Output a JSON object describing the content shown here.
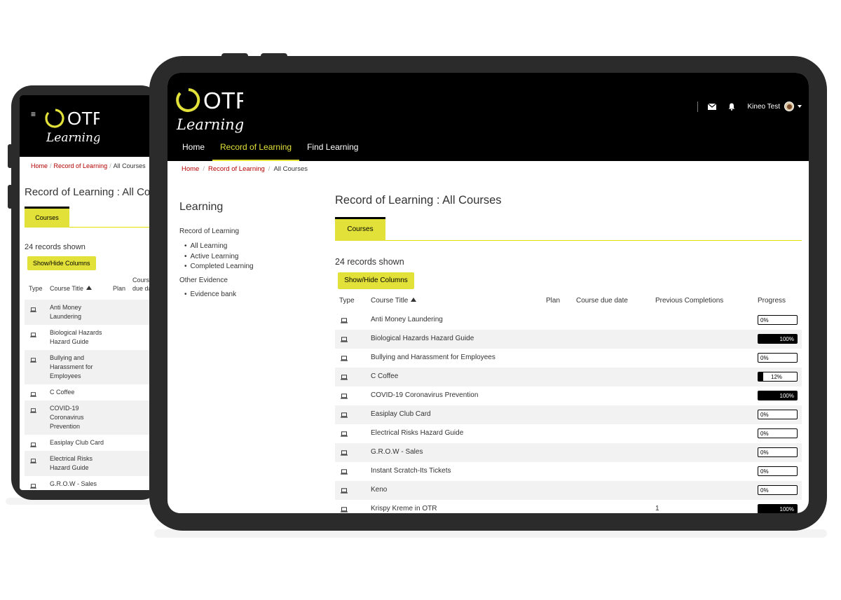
{
  "brand": {
    "logo_text": "OTR",
    "logo_sub": "Learning"
  },
  "colors": {
    "accent": "#e2e13a",
    "link": "#b30000",
    "header_bg": "#000000",
    "device_frame": "#2b2b2b"
  },
  "header": {
    "nav": [
      {
        "label": "Home",
        "active": false
      },
      {
        "label": "Record of Learning",
        "active": true
      },
      {
        "label": "Find Learning",
        "active": false
      }
    ],
    "user_name": "Kineo Test",
    "icons": [
      "envelope-icon",
      "bell-icon",
      "avatar",
      "caret-down-icon"
    ]
  },
  "breadcrumb": {
    "home": "Home",
    "record": "Record of Learning",
    "current": "All Courses"
  },
  "sidebar": {
    "title": "Learning",
    "section1": "Record of Learning",
    "section1_items": [
      "All Learning",
      "Active Learning",
      "Completed Learning"
    ],
    "section2": "Other Evidence",
    "section2_items": [
      "Evidence bank"
    ]
  },
  "main": {
    "title": "Record of Learning : All Courses",
    "tab": "Courses",
    "records": "24 records shown",
    "show_hide": "Show/Hide Columns",
    "columns": {
      "type": "Type",
      "course_title": "Course Title",
      "plan": "Plan",
      "due": "Course due date",
      "prev": "Previous Completions",
      "progress": "Progress"
    },
    "rows": [
      {
        "title": "Anti Money Laundering",
        "completions": "",
        "progress": 0,
        "progress_label": "0%"
      },
      {
        "title": "Biological Hazards Hazard Guide",
        "completions": "",
        "progress": 1,
        "progress_label": "100%"
      },
      {
        "title": "Bullying and Harassment for Employees",
        "completions": "",
        "progress": 0,
        "progress_label": "0%"
      },
      {
        "title": "C Coffee",
        "completions": "",
        "progress": 0.12,
        "progress_label": "12%"
      },
      {
        "title": "COVID-19 Coronavirus Prevention",
        "completions": "",
        "progress": 1,
        "progress_label": "100%"
      },
      {
        "title": "Easiplay Club Card",
        "completions": "",
        "progress": 0,
        "progress_label": "0%"
      },
      {
        "title": "Electrical Risks Hazard Guide",
        "completions": "",
        "progress": 0,
        "progress_label": "0%"
      },
      {
        "title": "G.R.O.W - Sales",
        "completions": "",
        "progress": 0,
        "progress_label": "0%"
      },
      {
        "title": "Instant Scratch-Its Tickets",
        "completions": "",
        "progress": 0,
        "progress_label": "0%"
      },
      {
        "title": "Keno",
        "completions": "",
        "progress": 0,
        "progress_label": "0%"
      },
      {
        "title": "Krispy Kreme in OTR",
        "completions": "1",
        "progress": 1,
        "progress_label": "100%"
      }
    ]
  },
  "phone": {
    "breadcrumb": {
      "home": "Home",
      "record": "Record of Learning",
      "current": "All Courses"
    },
    "title": "Record of Learning : All Cou",
    "tab": "Courses",
    "records": "24 records shown",
    "show_hide": "Show/Hide Columns",
    "columns": {
      "type": "Type",
      "course_title": "Course Title",
      "plan": "Plan",
      "due_line1": "Course",
      "due_line2": "due da"
    },
    "rows": [
      [
        "Anti Money",
        "Laundering"
      ],
      [
        "Biological Hazards",
        "Hazard Guide"
      ],
      [
        "Bullying and",
        "Harassment for",
        "Employees"
      ],
      [
        "C Coffee"
      ],
      [
        "COVID-19",
        "Coronavirus",
        "Prevention"
      ],
      [
        "Easiplay Club Card"
      ],
      [
        "Electrical Risks",
        "Hazard Guide"
      ],
      [
        "G.R.O.W - Sales"
      ]
    ]
  }
}
